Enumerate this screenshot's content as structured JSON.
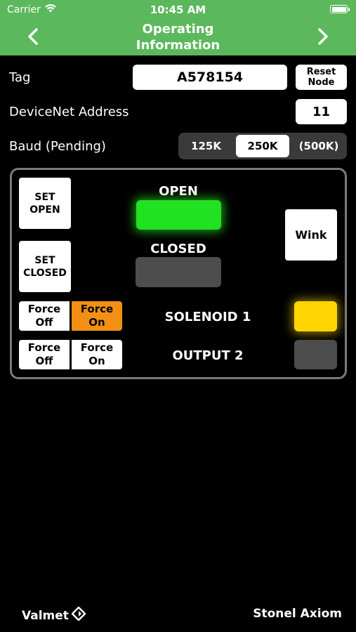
{
  "status_bar": {
    "carrier": "Carrier",
    "time": "10:45 AM"
  },
  "header": {
    "title_line1": "Operating",
    "title_line2": "Information"
  },
  "tag": {
    "label": "Tag",
    "value": "A578154",
    "reset_line1": "Reset",
    "reset_line2": "Node"
  },
  "devicenet": {
    "label": "DeviceNet Address",
    "value": "11"
  },
  "baud": {
    "label": "Baud (Pending)",
    "options": [
      "125K",
      "250K",
      "(500K)"
    ],
    "selected": "250K"
  },
  "panel": {
    "set_open_line1": "SET",
    "set_open_line2": "OPEN",
    "set_closed_line1": "SET",
    "set_closed_line2": "CLOSED",
    "open_label": "OPEN",
    "closed_label": "CLOSED",
    "wink": "Wink",
    "solenoid_label": "SOLENOID 1",
    "output_label": "OUTPUT 2",
    "force_off_line1": "Force",
    "force_off_line2": "Off",
    "force_on_line1": "Force",
    "force_on_line2": "On"
  },
  "footer": {
    "left_brand": "Valmet",
    "right_brand": "Stonel Axiom"
  },
  "colors": {
    "header": "#5cb85c",
    "led_open": "#22e022",
    "led_solenoid": "#ffd500",
    "force_active": "#f39014"
  }
}
